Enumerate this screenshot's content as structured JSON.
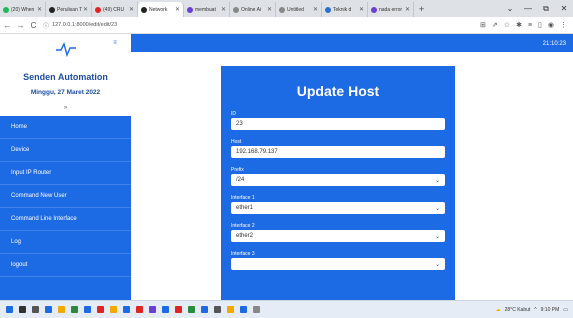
{
  "browser": {
    "tabs": [
      {
        "title": "(20) When",
        "color": "#1db954"
      },
      {
        "title": "Perulisan T",
        "color": "#222222"
      },
      {
        "title": "(49) CRU",
        "color": "#e02424"
      },
      {
        "title": "Network",
        "color": "#222222",
        "active": true
      },
      {
        "title": "membuat",
        "color": "#6b3fd4"
      },
      {
        "title": "Online Ai",
        "color": "#888888"
      },
      {
        "title": "Untitled",
        "color": "#888888"
      },
      {
        "title": "Teknik d",
        "color": "#2b6fd6"
      },
      {
        "title": "nada error",
        "color": "#6b3fd4"
      }
    ],
    "new_tab": "+",
    "url": "127.0.0.1:8000/edit/edit/23",
    "window_controls": [
      "⌄",
      "—",
      "⧉",
      "✕"
    ]
  },
  "sidebar": {
    "title": "Senden Automation",
    "date": "Minggu, 27 Maret 2022",
    "chevron": "»",
    "menu": [
      {
        "label": "Home"
      },
      {
        "label": "Device"
      },
      {
        "label": "Input IP Router"
      },
      {
        "label": "Command New User"
      },
      {
        "label": "Command Line Interface"
      },
      {
        "label": "Log"
      },
      {
        "label": "logout"
      }
    ]
  },
  "topbar": {
    "menu_toggle": "≡",
    "time": "21:10:23"
  },
  "form": {
    "title": "Update Host",
    "fields": [
      {
        "label": "ID",
        "value": "23",
        "type": "text"
      },
      {
        "label": "Host",
        "value": "192.168.79.137",
        "type": "text"
      },
      {
        "label": "Prefix",
        "value": "/24",
        "type": "select"
      },
      {
        "label": "Interface 1",
        "value": "ether1",
        "type": "select"
      },
      {
        "label": "Interface 2",
        "value": "ether2",
        "type": "select"
      },
      {
        "label": "Interface 3",
        "value": "",
        "type": "select"
      }
    ]
  },
  "taskbar": {
    "weather": "28°C Kabut",
    "time": "9:10 PM",
    "icons": [
      "#1d6ae5",
      "#333333",
      "#555555",
      "#1d6ae5",
      "#f2a900",
      "#2b8a3e",
      "#1d6ae5",
      "#e02424",
      "#f2a900",
      "#1d6ae5",
      "#e02424",
      "#6b3fd4",
      "#1d6ae5",
      "#e02424",
      "#2b8a3e",
      "#1d6ae5",
      "#555555",
      "#f2a900",
      "#1d6ae5",
      "#888888"
    ]
  }
}
